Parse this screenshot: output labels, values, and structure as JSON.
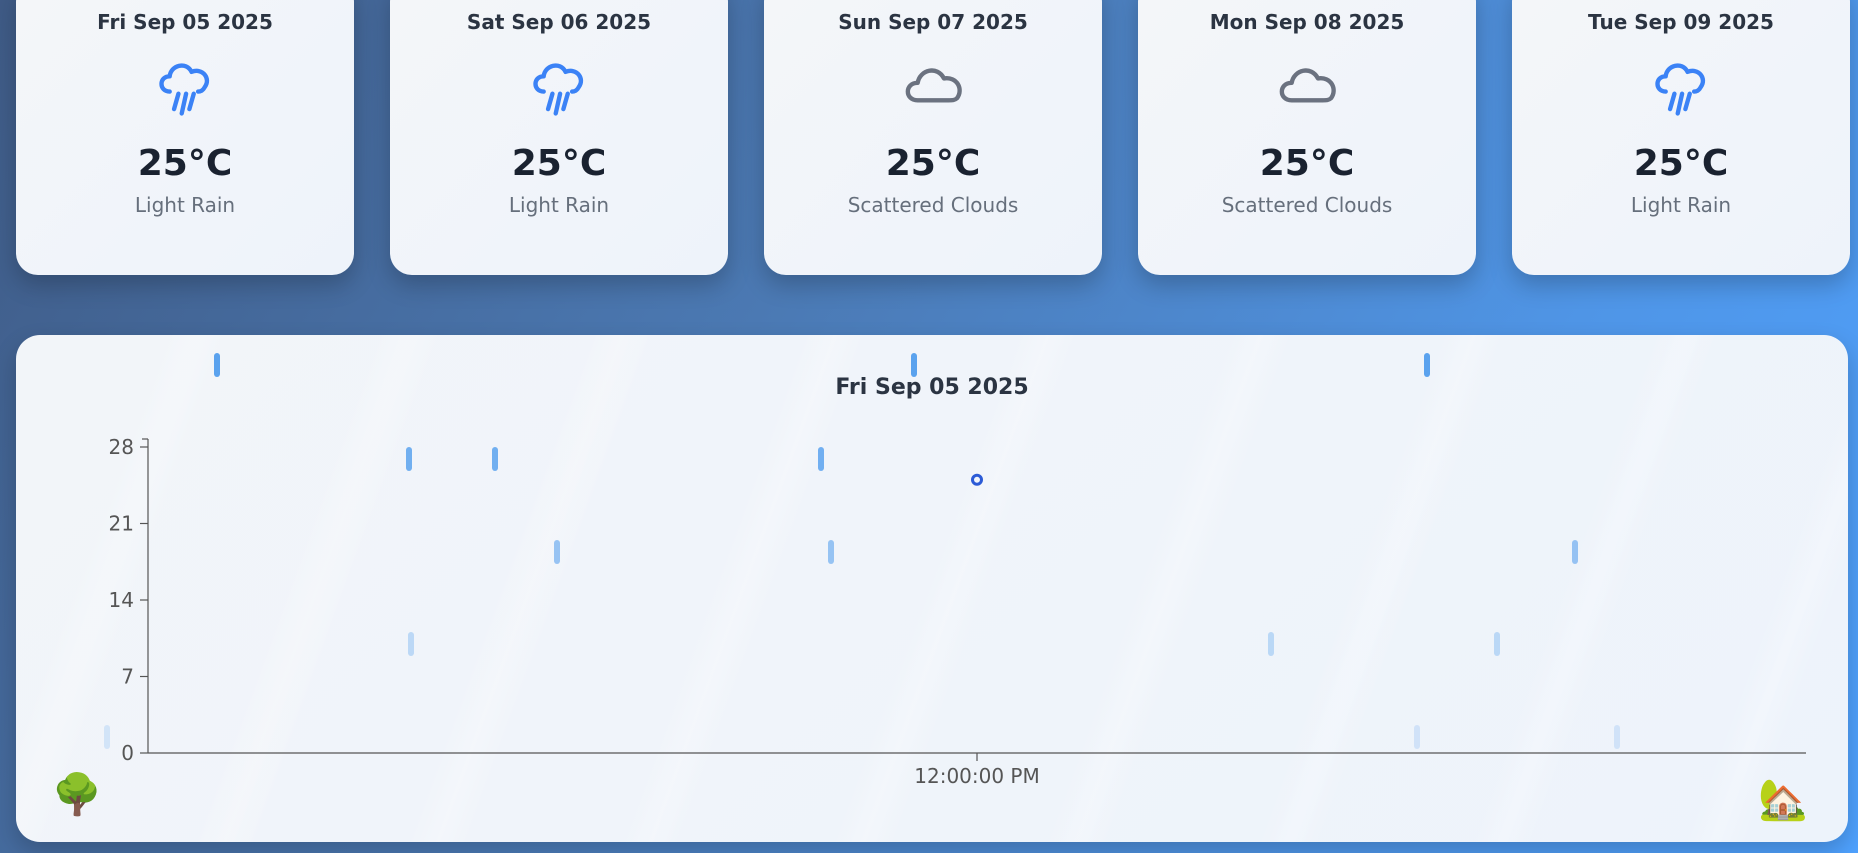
{
  "forecast": [
    {
      "date": "Fri Sep 05 2025",
      "temp": "25°C",
      "desc": "Light Rain",
      "icon": "rain-cloud-icon"
    },
    {
      "date": "Sat Sep 06 2025",
      "temp": "25°C",
      "desc": "Light Rain",
      "icon": "rain-cloud-icon"
    },
    {
      "date": "Sun Sep 07 2025",
      "temp": "25°C",
      "desc": "Scattered Clouds",
      "icon": "cloud-icon"
    },
    {
      "date": "Mon Sep 08 2025",
      "temp": "25°C",
      "desc": "Scattered Clouds",
      "icon": "cloud-icon"
    },
    {
      "date": "Tue Sep 09 2025",
      "temp": "25°C",
      "desc": "Light Rain",
      "icon": "rain-cloud-icon"
    }
  ],
  "colors": {
    "rain_icon": "#3b82f6",
    "cloud_icon": "#6b7280",
    "point": "#2c5bd6"
  },
  "chart_data": {
    "type": "scatter",
    "title": "Fri Sep 05 2025",
    "xlabel": "",
    "ylabel": "",
    "ylim": [
      0,
      28
    ],
    "yticks": [
      "0",
      "7",
      "14",
      "21",
      "28"
    ],
    "xticks": [
      "12:00:00 PM"
    ],
    "series": [
      {
        "x": [
          "12:00:00 PM"
        ],
        "values": [
          25
        ]
      }
    ],
    "grid": false
  },
  "decor": {
    "left_icon": "tree-icon",
    "right_icon": "house-icon"
  }
}
